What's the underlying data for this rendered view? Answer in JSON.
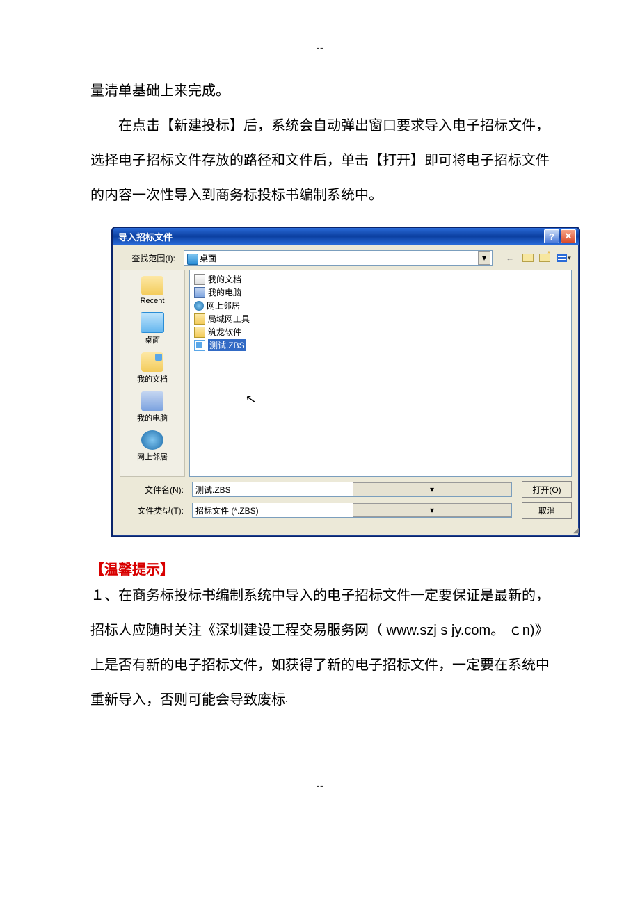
{
  "decor": {
    "dash": "--"
  },
  "prose": {
    "line1": "量清单基础上来完成。",
    "para2": "在点击【新建投标】后，系统会自动弹出窗口要求导入电子招标文件，选择电子招标文件存放的路径和文件后，单击【打开】即可将电子招标文件的内容一次性导入到商务标投标书编制系统中。"
  },
  "dialog": {
    "title": "导入招标文件",
    "help_glyph": "?",
    "close_glyph": "✕",
    "lookin_label": "查找范围(I):",
    "lookin_value": "桌面",
    "toolbar": {
      "back_glyph": "←",
      "view_drop": "▾"
    },
    "places": {
      "recent": "Recent",
      "desktop": "桌面",
      "mydocs": "我的文档",
      "mycomp": "我的电脑",
      "network": "网上邻居"
    },
    "files": [
      {
        "name": "我的文档",
        "icon": "folder-docs"
      },
      {
        "name": "我的电脑",
        "icon": "computer"
      },
      {
        "name": "网上邻居",
        "icon": "network"
      },
      {
        "name": "局域网工具",
        "icon": "folder"
      },
      {
        "name": "筑龙软件",
        "icon": "folder"
      },
      {
        "name": "测试.ZBS",
        "icon": "zbs",
        "selected": true
      }
    ],
    "filename_label": "文件名(N):",
    "filename_value": "测试.ZBS",
    "filetype_label": "文件类型(T):",
    "filetype_value": "招标文件 (*.ZBS)",
    "open_btn": "打开(O)",
    "cancel_btn": "取消",
    "drop_glyph": "▾"
  },
  "tip": {
    "heading": "【温馨提示】",
    "body_prefix": "１、在商务标投标书编制系统中导入的电子招标文件一定要保证是最新的，招标人应随时关注《深圳建设工程交易服务网（ www.szj s jy.com。 ｃn)》上是否有新的电子招标文件，如获得了新的电子招标文件，一定要在系统中重新导入，否则可能会导致废标",
    "body_suffix": "."
  }
}
